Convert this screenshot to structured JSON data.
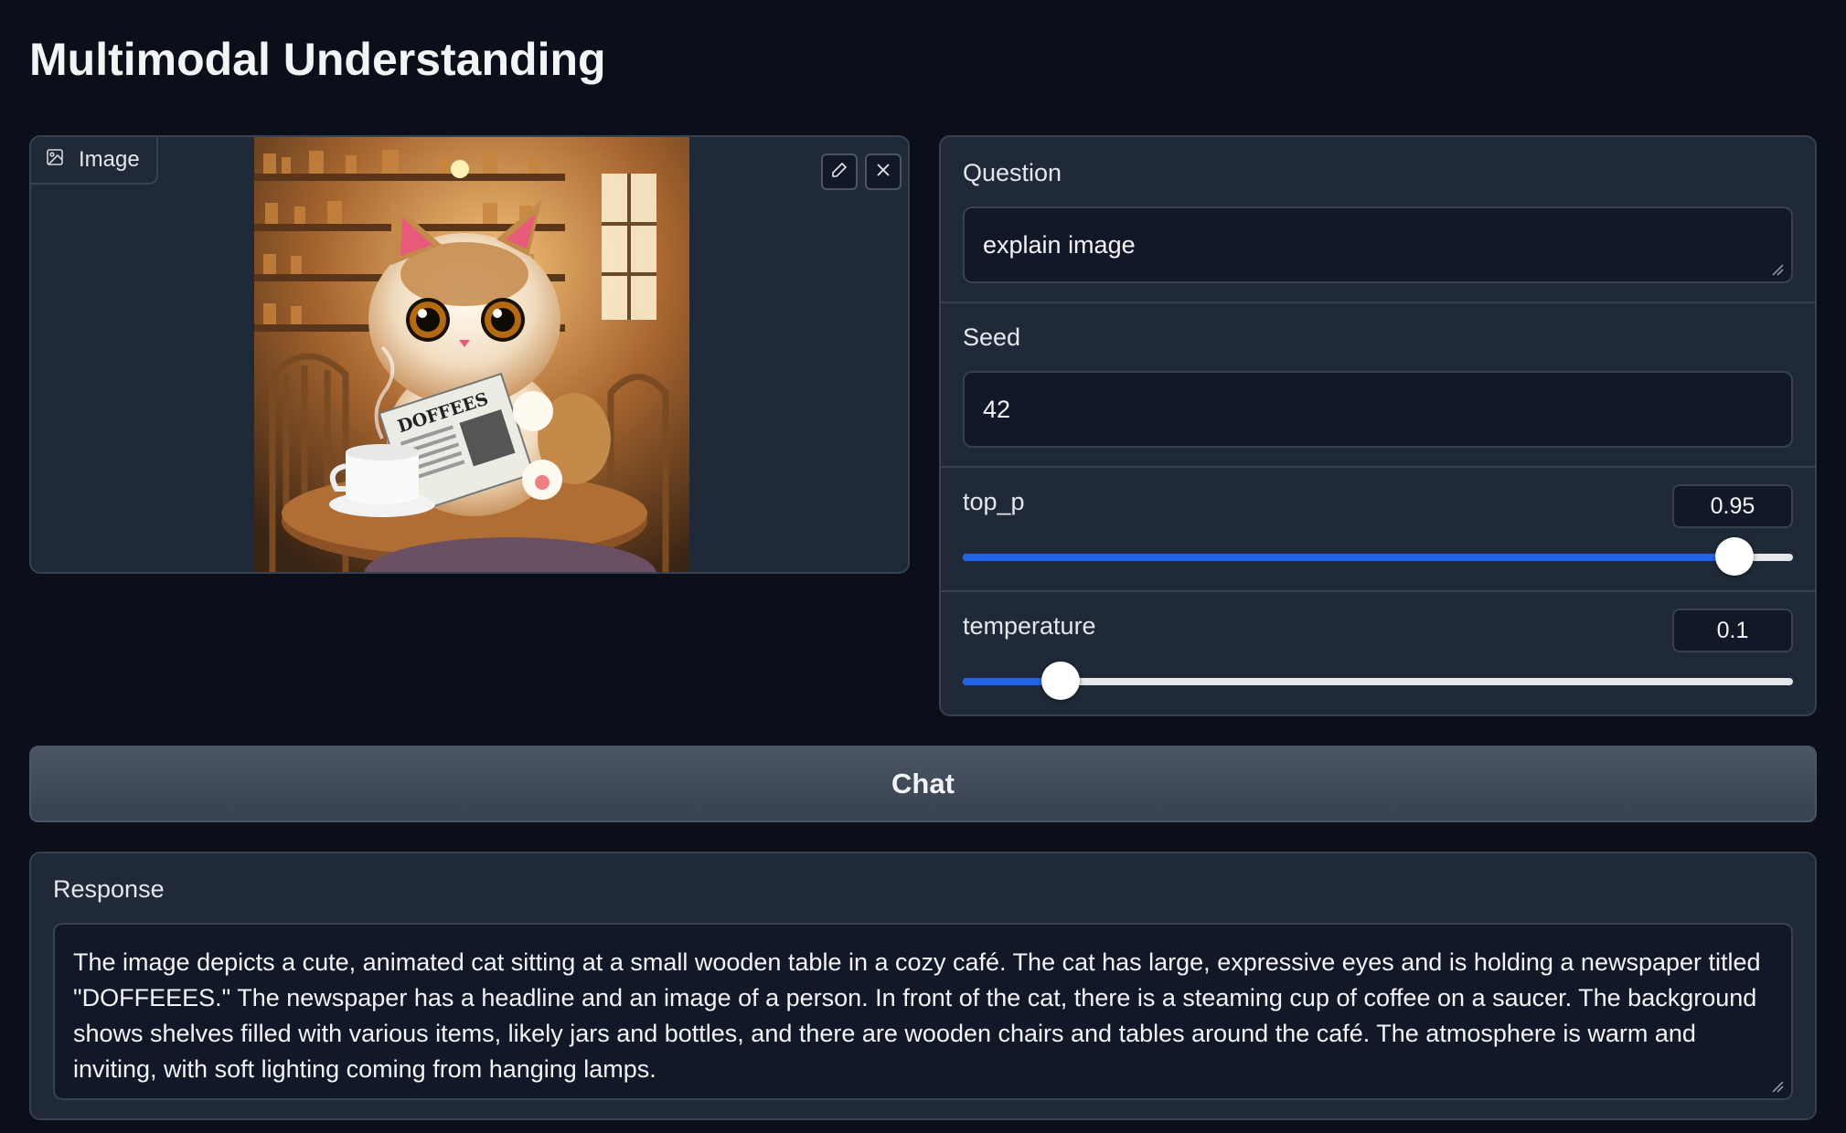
{
  "page": {
    "title": "Multimodal Understanding"
  },
  "image_panel": {
    "label": "Image"
  },
  "question": {
    "label": "Question",
    "value": "explain image"
  },
  "seed": {
    "label": "Seed",
    "value": "42"
  },
  "top_p": {
    "label": "top_p",
    "value": "0.95",
    "fraction": 0.93
  },
  "temperature": {
    "label": "temperature",
    "value": "0.1",
    "fraction": 0.118
  },
  "chat_button": {
    "label": "Chat"
  },
  "response": {
    "label": "Response",
    "text": "The image depicts a cute, animated cat sitting at a small wooden table in a cozy café. The cat has large, expressive eyes and is holding a newspaper titled \"DOFFEEES.\" The newspaper has a headline and an image of a person. In front of the cat, there is a steaming cup of coffee on a saucer. The background shows shelves filled with various items, likely jars and bottles, and there are wooden chairs and tables around the café. The atmosphere is warm and inviting, with soft lighting coming from hanging lamps."
  },
  "image_content": {
    "newspaper_title": "DOFFEES"
  },
  "colors": {
    "accent": "#2563eb",
    "background": "#0b0f19",
    "panel": "#1f2937"
  }
}
